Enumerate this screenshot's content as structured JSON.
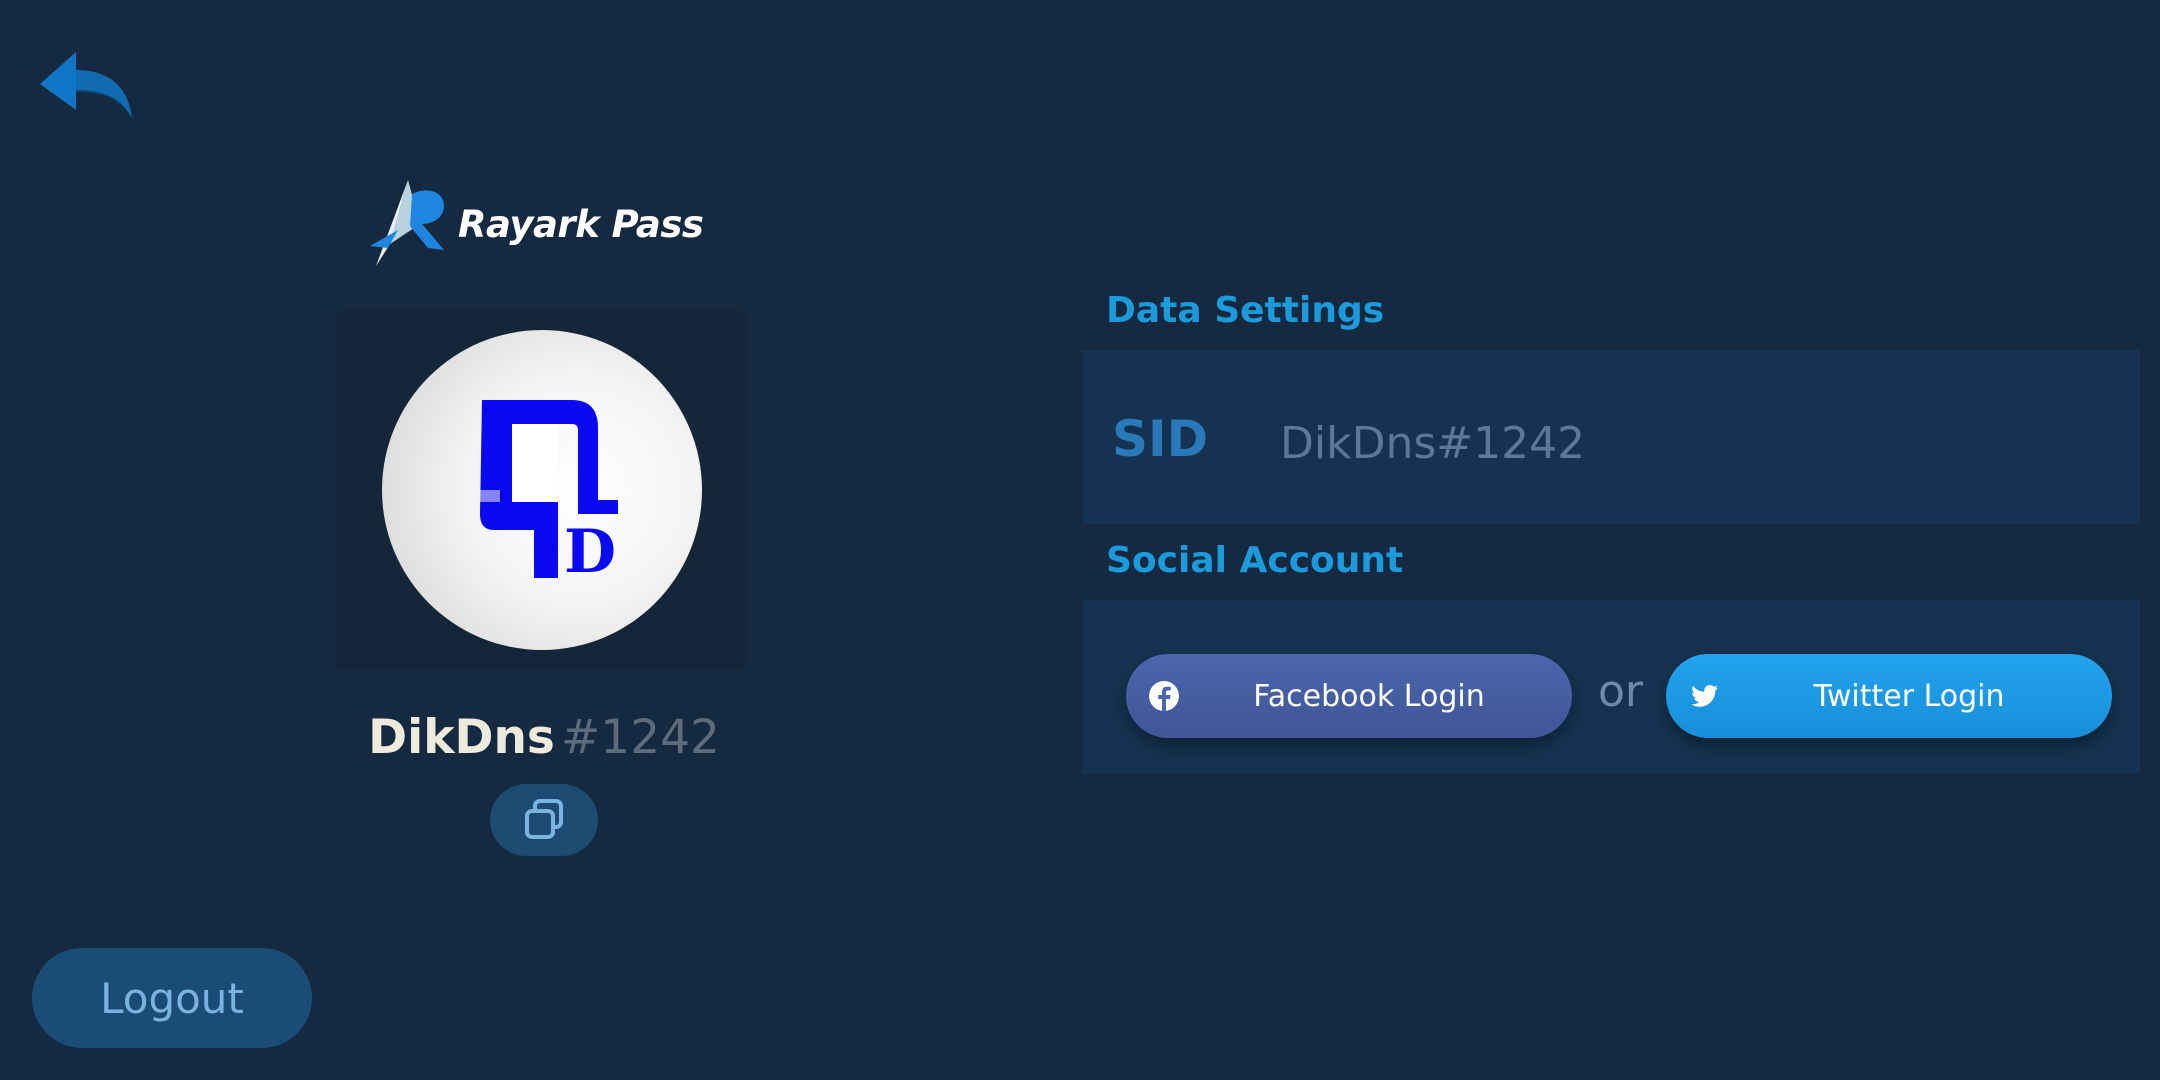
{
  "nav": {
    "back_icon": "back-arrow-icon"
  },
  "brand": {
    "name": "Rayark Pass",
    "logo_icon": "rayark-logo-icon"
  },
  "profile": {
    "avatar_icon": "qd-avatar-icon",
    "avatar_text": "D",
    "username": "DikDns",
    "tag": "#1242",
    "copy_icon": "copy-icon"
  },
  "data_settings": {
    "title": "Data Settings",
    "sid_label": "SID",
    "sid_value": "DikDns#1242"
  },
  "social_account": {
    "title": "Social Account",
    "facebook_label": "Facebook Login",
    "facebook_icon": "facebook-icon",
    "separator": "or",
    "twitter_label": "Twitter Login",
    "twitter_icon": "twitter-icon"
  },
  "footer": {
    "logout_label": "Logout"
  },
  "colors": {
    "background": "#152940",
    "accent": "#1b9bdb",
    "facebook": "#4b66ad",
    "twitter": "#22a3ef"
  }
}
